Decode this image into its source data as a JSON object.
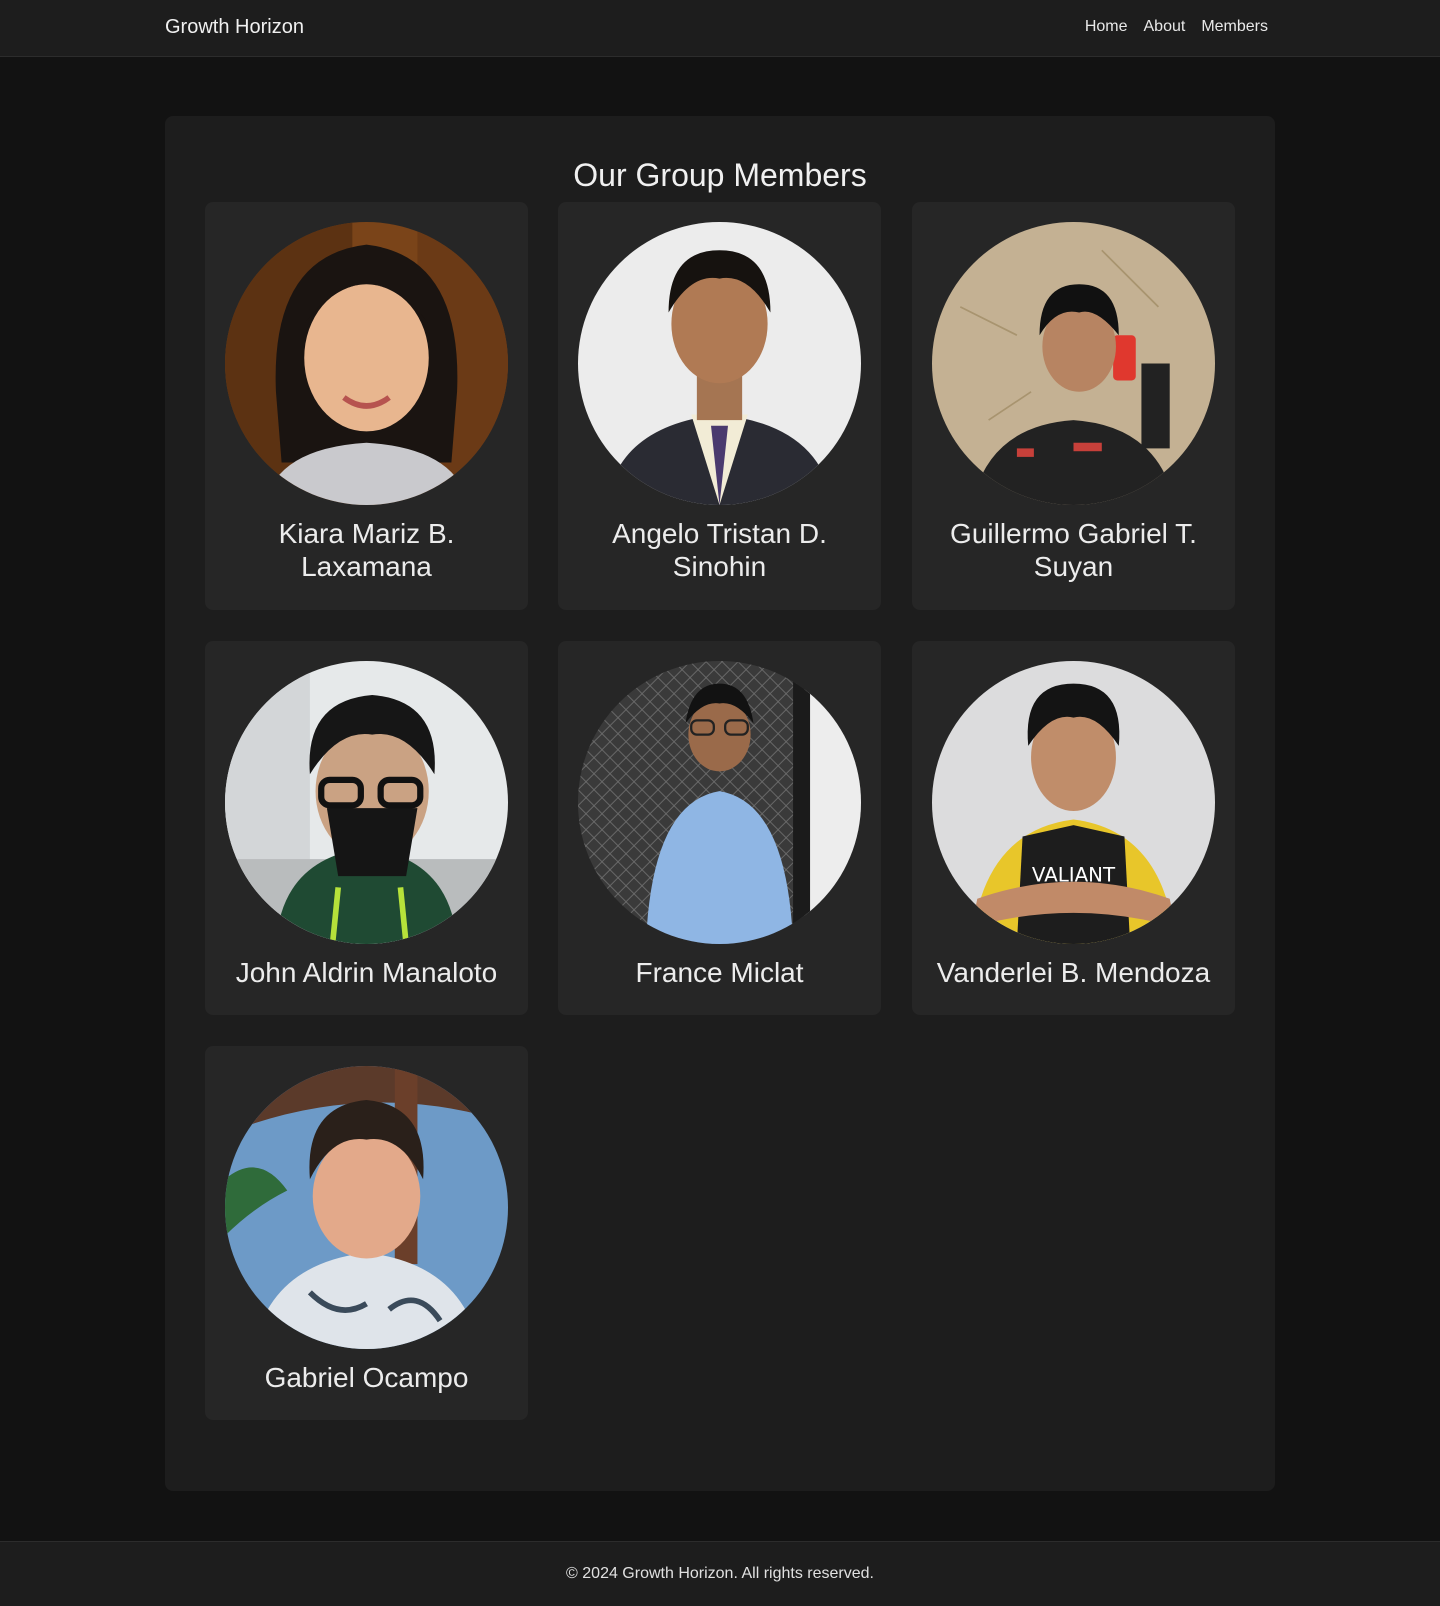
{
  "navbar": {
    "brand": "Growth Horizon",
    "links": [
      "Home",
      "About",
      "Members"
    ]
  },
  "main": {
    "title": "Our Group Members",
    "members": [
      {
        "name": "Kiara Mariz B. Laxamana"
      },
      {
        "name": "Angelo Tristan D. Sinohin"
      },
      {
        "name": "Guillermo Gabriel T. Suyan"
      },
      {
        "name": "John Aldrin Manaloto"
      },
      {
        "name": "France Miclat"
      },
      {
        "name": "Vanderlei B. Mendoza"
      },
      {
        "name": "Gabriel Ocampo"
      }
    ]
  },
  "footer": {
    "text": "© 2024 Growth Horizon. All rights reserved."
  }
}
